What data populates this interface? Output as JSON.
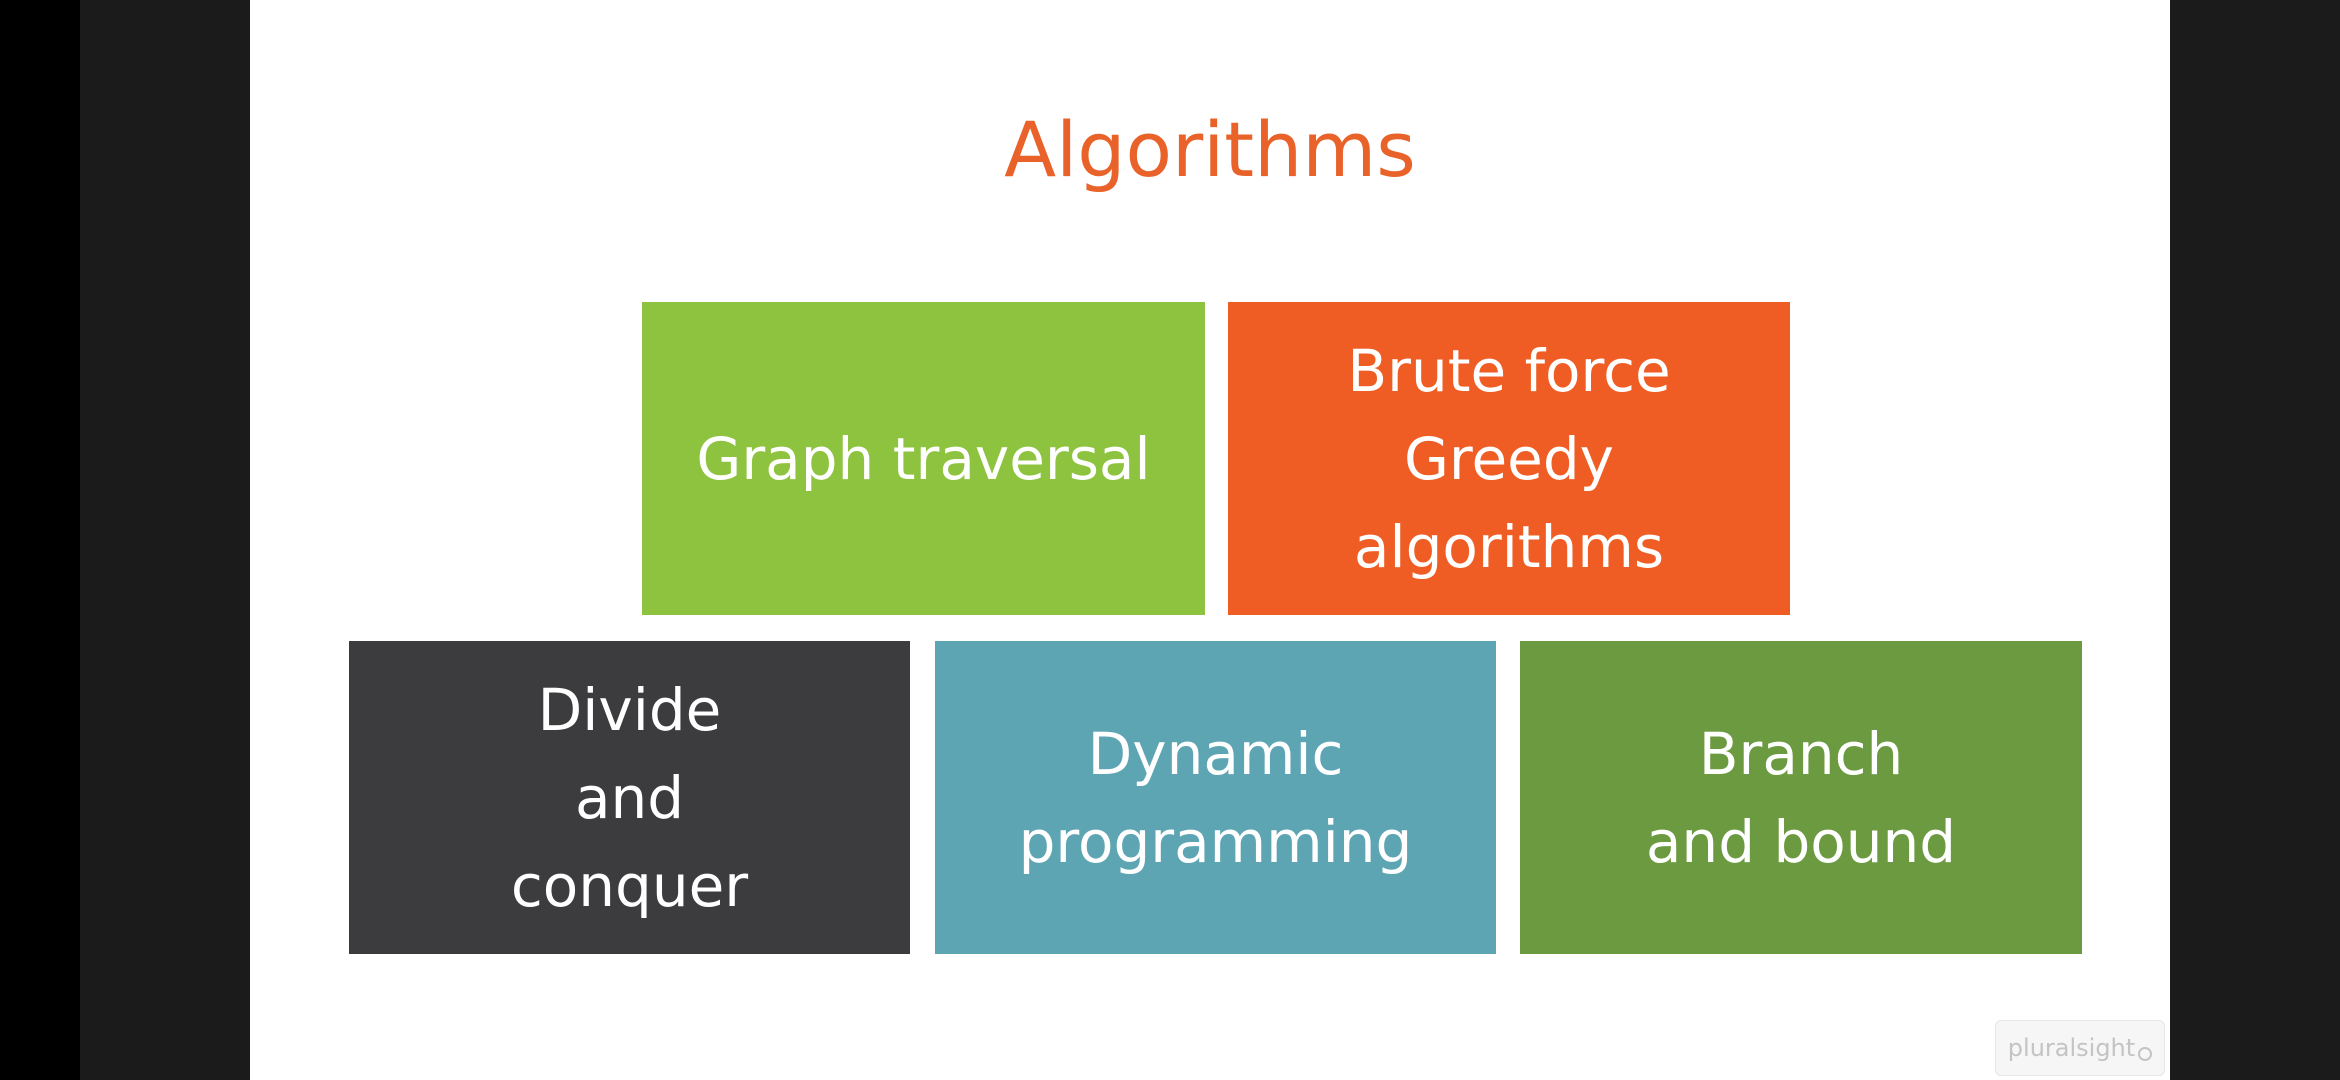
{
  "slide": {
    "title": "Algorithms",
    "tiles": [
      {
        "label": "Graph traversal",
        "color": "#8dc33e"
      },
      {
        "label": "Brute force\nGreedy algorithms",
        "color": "#ef5d24"
      },
      {
        "label": "Divide\nand\nconquer",
        "color": "#3c3c3f"
      },
      {
        "label": "Dynamic\nprogramming",
        "color": "#5ea5b4"
      },
      {
        "label": "Branch\nand bound",
        "color": "#6c9a41"
      }
    ]
  },
  "watermark": {
    "text": "pluralsight"
  },
  "colors": {
    "title": "#e8622a",
    "background": "#ffffff",
    "letterbox": "#1b1b1b"
  }
}
